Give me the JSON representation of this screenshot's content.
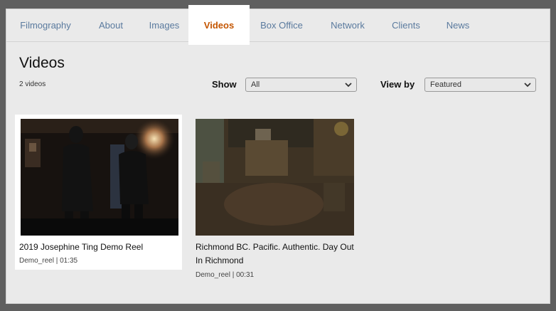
{
  "tabs": [
    {
      "label": "Filmography"
    },
    {
      "label": "About"
    },
    {
      "label": "Images"
    },
    {
      "label": "Videos"
    },
    {
      "label": "Box Office"
    },
    {
      "label": "Network"
    },
    {
      "label": "Clients"
    },
    {
      "label": "News"
    }
  ],
  "active_tab": "Videos",
  "page": {
    "title": "Videos",
    "count": "2 videos"
  },
  "filters": {
    "show_label": "Show",
    "show_value": "All",
    "viewby_label": "View by",
    "viewby_value": "Featured"
  },
  "videos": [
    {
      "title": "2019 Josephine Ting Demo Reel",
      "meta": "Demo_reel | 01:35"
    },
    {
      "title": "Richmond BC. Pacific. Authentic. Day Out In Richmond",
      "meta": "Demo_reel | 00:31"
    }
  ],
  "colors": {
    "active_tab": "#c45500",
    "tab_text": "#5a7a9e",
    "overlay": "#5f5f5f"
  }
}
